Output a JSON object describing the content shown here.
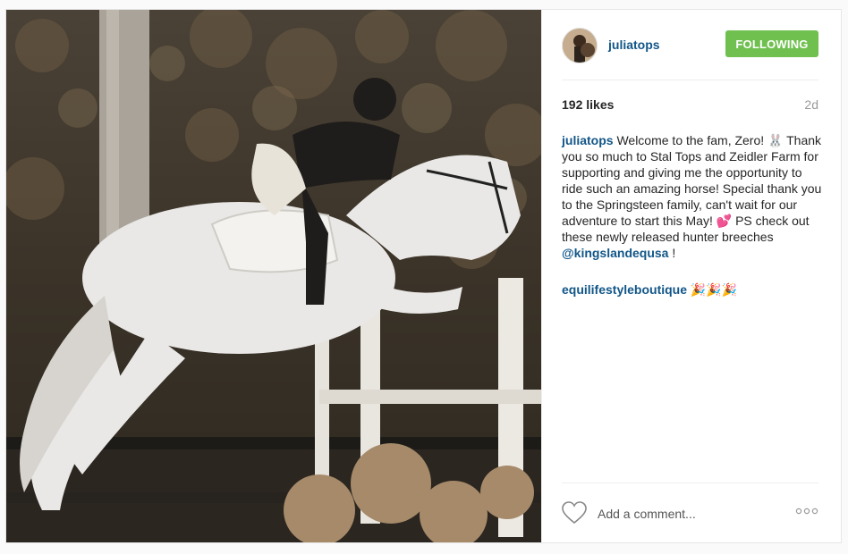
{
  "post": {
    "username": "juliatops",
    "follow_label": "FOLLOWING",
    "likes": "192 likes",
    "age": "2d",
    "caption": {
      "author": "juliatops",
      "text_1": " Welcome to the fam, Zero! ",
      "emoji_1": "🐰",
      "text_2": " Thank you so much to Stal Tops and Zeidler Farm for supporting and giving me the opportunity to ride such an amazing horse! Special thank you to the Springsteen family, can't wait for our adventure to start this May! ",
      "emoji_2": "💕",
      "text_3": " PS check out these newly released hunter breeches ",
      "mention": "@kingslandequsa",
      "text_4": " !"
    },
    "comment": {
      "author": "equilifestyleboutique",
      "emojis": " 🎉🎉🎉"
    },
    "add_comment_placeholder": "Add a comment...",
    "icons": {
      "like": "heart-icon",
      "more": "more-options-icon"
    },
    "colors": {
      "link": "#125688",
      "follow_button": "#70c050"
    }
  }
}
